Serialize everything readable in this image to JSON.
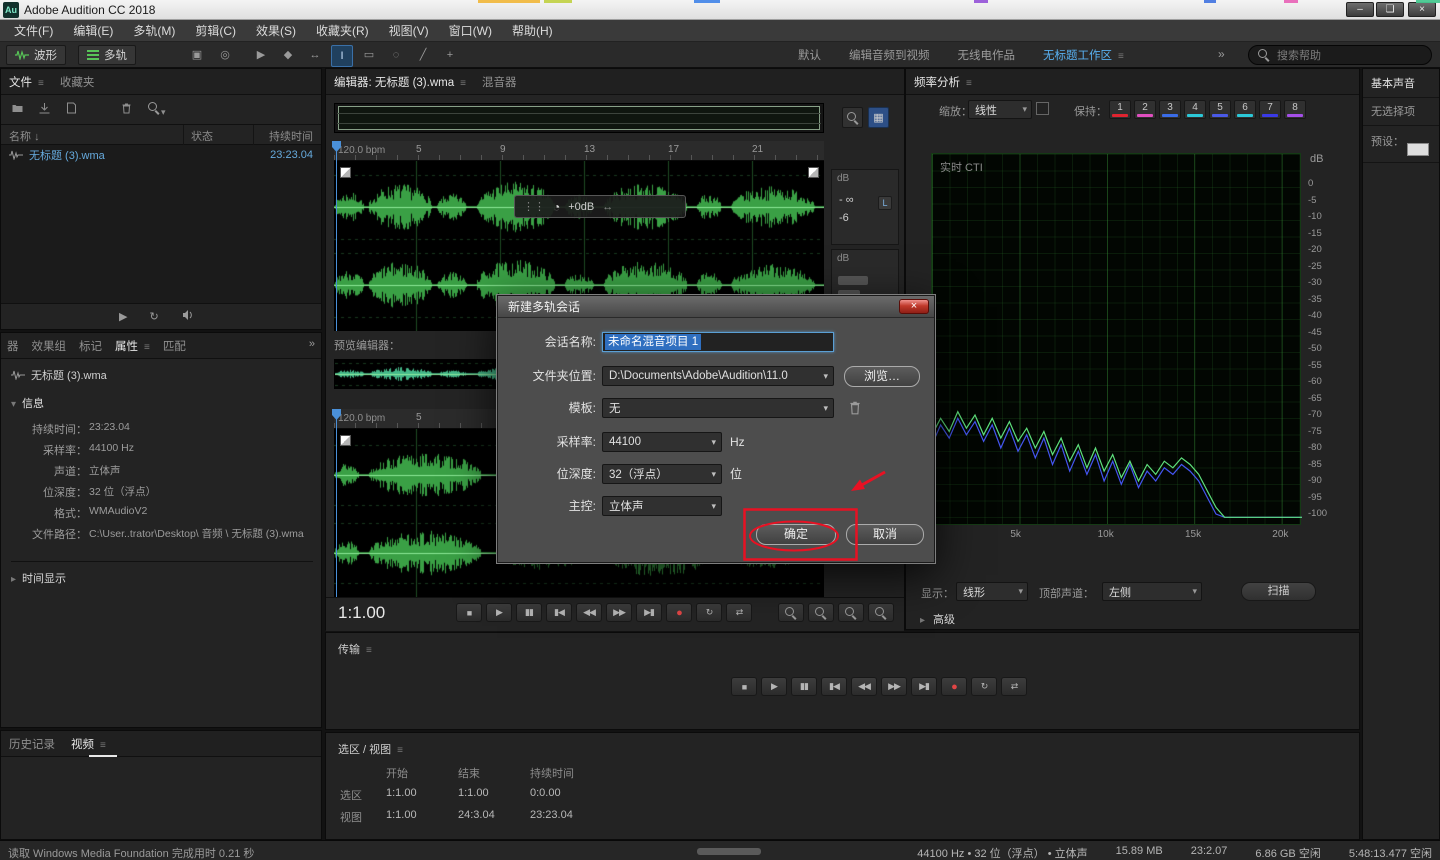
{
  "colors": {
    "accent_blue": "#58b0f0",
    "wave_green": "#3aa045",
    "spectrum_green": "#5ee07c",
    "spectrum_blue": "#4455f0",
    "annotation_red": "#e81123"
  },
  "titlebar": {
    "app_icon": "Au",
    "title": "Adobe Audition CC 2018"
  },
  "menubar": {
    "items": [
      "文件(F)",
      "编辑(E)",
      "多轨(M)",
      "剪辑(C)",
      "效果(S)",
      "收藏夹(R)",
      "视图(V)",
      "窗口(W)",
      "帮助(H)"
    ]
  },
  "toolbar": {
    "waveform_button": "波形",
    "multitrack_button": "多轨",
    "monitor_icons": [
      {
        "name": "video-display-icon",
        "glyph": "▣"
      },
      {
        "name": "cd-layout-icon",
        "glyph": "◎"
      }
    ],
    "tools": [
      {
        "name": "move-playhead-tool-icon",
        "glyph": "▶"
      },
      {
        "name": "razor-tool-icon",
        "glyph": "◆"
      },
      {
        "name": "slip-tool-icon",
        "glyph": "↔"
      },
      {
        "name": "time-selection-tool-icon",
        "glyph": "I",
        "active": true
      },
      {
        "name": "marquee-selection-tool-icon",
        "glyph": "▭"
      },
      {
        "name": "lasso-selection-tool-icon",
        "glyph": "◌"
      },
      {
        "name": "paintbrush-selection-tool-icon",
        "glyph": "╱"
      },
      {
        "name": "spot-healing-brush-tool-icon",
        "glyph": "+"
      }
    ],
    "workspaces": [
      "默认",
      "编辑音频到视频",
      "无线电作品",
      "无标题工作区"
    ],
    "active_workspace_index": 3,
    "overflow": "»",
    "search_placeholder": "搜索帮助"
  },
  "files_panel": {
    "tab_files": "文件",
    "tab_favorites": "收藏夹",
    "columns": {
      "name": "名称",
      "status": "状态",
      "duration": "持续时间"
    },
    "sort_arrow": "↓",
    "files": [
      {
        "name": "无标题 (3).wma",
        "duration": "23:23.04"
      }
    ]
  },
  "properties_panel": {
    "tabs": [
      "器",
      "效果组",
      "标记",
      "属性",
      "匹配"
    ],
    "active_tab": "属性",
    "overflow": "»",
    "file_name": "无标题 (3).wma",
    "info_header": "信息",
    "info_rows": [
      {
        "label": "持续时间：",
        "value": "23:23.04"
      },
      {
        "label": "采样率：",
        "value": "44100 Hz"
      },
      {
        "label": "声道：",
        "value": "立体声"
      },
      {
        "label": "位深度：",
        "value": "32 位（浮点）"
      },
      {
        "label": "格式：",
        "value": "WMAudioV2"
      },
      {
        "label": "文件路径：",
        "value": "C:\\User..trator\\Desktop\\ 音频 \\ 无标题 (3).wma"
      }
    ],
    "time_display_header": "时间显示"
  },
  "history_panel": {
    "tab_history": "历史记录",
    "tab_video": "视频"
  },
  "editor": {
    "tab_editor": "编辑器: 无标题 (3).wma",
    "tab_mixer": "混音器",
    "bpm": "120.0 bpm",
    "ruler_marks": [
      "5",
      "9",
      "13",
      "17",
      "21"
    ],
    "bpm2": "120.0 bpm",
    "ruler2_marks": [
      "5"
    ],
    "hud_gain": "+0dB",
    "preview_label": "预览编辑器：",
    "meter1": {
      "unit": "dB",
      "values": [
        "- ∞",
        "-6"
      ]
    },
    "meter2": {
      "unit": "dB"
    },
    "time_display": "1:1.00"
  },
  "transport_buttons": [
    {
      "name": "stop",
      "glyph": "■"
    },
    {
      "name": "play",
      "glyph": "▶"
    },
    {
      "name": "pause",
      "glyph": "▮▮"
    },
    {
      "name": "go-to-previous",
      "glyph": "▮◀"
    },
    {
      "name": "rewind",
      "glyph": "◀◀"
    },
    {
      "name": "fast-forward",
      "glyph": "▶▶"
    },
    {
      "name": "go-to-next",
      "glyph": "▶▮"
    },
    {
      "name": "record",
      "glyph": "●"
    },
    {
      "name": "loop",
      "glyph": "↻"
    },
    {
      "name": "skip-selection",
      "glyph": "⇄"
    }
  ],
  "transport_panel": {
    "title": "传输"
  },
  "selection_panel": {
    "title": "选区 / 视图",
    "columns": [
      "开始",
      "结束",
      "持续时间"
    ],
    "rows": [
      {
        "label": "选区",
        "values": [
          "1:1.00",
          "1:1.00",
          "0:0.00"
        ]
      },
      {
        "label": "视图",
        "values": [
          "1:1.00",
          "24:3.04",
          "23:23.04"
        ]
      }
    ]
  },
  "frequency_panel": {
    "title": "频率分析",
    "scale_label": "缩放：",
    "scale_value": "线性",
    "hold_label": "保持：",
    "hold_buttons": [
      {
        "n": "1",
        "color": "#e02430"
      },
      {
        "n": "2",
        "color": "#e04fc0"
      },
      {
        "n": "3",
        "color": "#3a6ce8"
      },
      {
        "n": "4",
        "color": "#2cc8d8"
      },
      {
        "n": "5",
        "color": "#4a5ae8"
      },
      {
        "n": "6",
        "color": "#2cc8d8"
      },
      {
        "n": "7",
        "color": "#3a3ae8"
      },
      {
        "n": "8",
        "color": "#a44fe8"
      }
    ],
    "graph_label": "实时 CTI",
    "db_unit": "dB",
    "db_ticks": [
      "0",
      "-5",
      "-10",
      "-15",
      "-20",
      "-25",
      "-30",
      "-35",
      "-40",
      "-45",
      "-50",
      "-55",
      "-60",
      "-65",
      "-70",
      "-75",
      "-80",
      "-85",
      "-90",
      "-95",
      "-100"
    ],
    "freq_labels": [
      "5k",
      "10k",
      "15k",
      "20k"
    ],
    "display_label": "显示：",
    "display_value": "线形",
    "top_channel_label": "顶部声道：",
    "top_channel_value": "左侧",
    "scan_button": "扫描",
    "advanced": "高级",
    "spectrum_green": [
      -76,
      -71,
      -75,
      -69,
      -74,
      -70,
      -76,
      -71,
      -77,
      -72,
      -78,
      -74,
      -80,
      -75,
      -82,
      -77,
      -84,
      -79,
      -86,
      -80,
      -87,
      -82,
      -89,
      -84,
      -90,
      -85,
      -88,
      -84,
      -86,
      -83,
      -85,
      -88,
      -93,
      -98,
      -101,
      -101,
      -101,
      -101,
      -101,
      -101,
      -101,
      -101,
      -101,
      -101
    ],
    "spectrum_blue": [
      -79,
      -73,
      -77,
      -71,
      -76,
      -72,
      -78,
      -73,
      -80,
      -74,
      -81,
      -76,
      -83,
      -77,
      -85,
      -79,
      -87,
      -81,
      -88,
      -82,
      -90,
      -84,
      -91,
      -85,
      -92,
      -87,
      -90,
      -86,
      -88,
      -85,
      -87,
      -90,
      -95,
      -100,
      -101,
      -101,
      -101,
      -101,
      -101,
      -101,
      -101,
      -101,
      -101,
      -101
    ]
  },
  "essential_sound": {
    "title": "基本声音",
    "empty_text": "无选择项",
    "preset_label": "预设："
  },
  "dialog": {
    "title": "新建多轨会话",
    "fields": {
      "session_name_label": "会话名称:",
      "session_name_value": "未命名混音项目 1",
      "folder_label": "文件夹位置:",
      "folder_value": "D:\\Documents\\Adobe\\Audition\\11.0",
      "browse_button": "浏览…",
      "template_label": "模板:",
      "template_value": "无",
      "sample_rate_label": "采样率:",
      "sample_rate_value": "44100",
      "sample_rate_unit": "Hz",
      "bit_depth_label": "位深度:",
      "bit_depth_value": "32（浮点）",
      "bit_depth_unit": "位",
      "master_label": "主控:",
      "master_value": "立体声"
    },
    "ok_button": "确定",
    "cancel_button": "取消"
  },
  "statusbar": {
    "left": "读取 Windows Media Foundation 完成用时 0.21 秒",
    "right": [
      "44100 Hz • 32 位（浮点） • 立体声",
      "15.89 MB",
      "23:2.07",
      "6.86 GB 空闲",
      "5:48:13.477 空闲"
    ]
  }
}
